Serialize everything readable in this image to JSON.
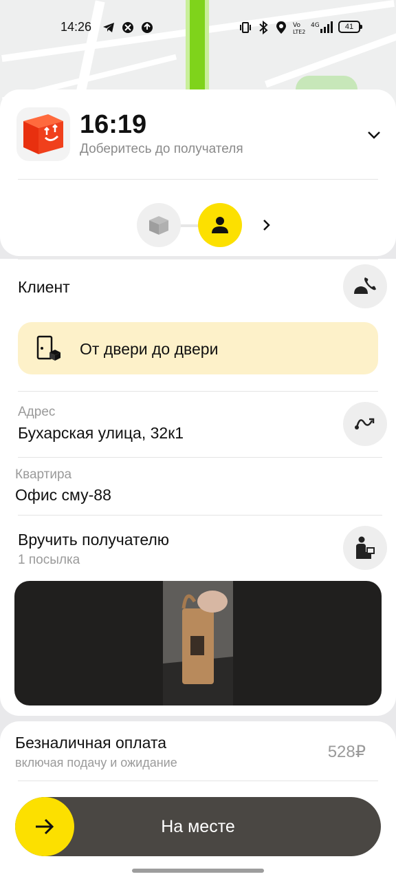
{
  "status_bar": {
    "time": "14:26",
    "battery": "41",
    "icons": [
      "telegram-icon",
      "vpn-icon",
      "upload-icon",
      "vibrate-icon",
      "bluetooth-icon",
      "location-icon",
      "volte-icon",
      "signal-4g-icon"
    ]
  },
  "order_header": {
    "eta": "16:19",
    "subtitle": "Доберитесь до получателя"
  },
  "client": {
    "label": "Клиент"
  },
  "door_to_door": {
    "label": "От двери до двери"
  },
  "address": {
    "caption": "Адрес",
    "value": "Бухарская улица, 32к1"
  },
  "apartment": {
    "caption": "Квартира",
    "value": "Офис сму-88"
  },
  "handover": {
    "title": "Вручить получателю",
    "subtitle": "1 посылка"
  },
  "payment": {
    "title": "Безналичная оплата",
    "subtitle": "включая подачу и ожидание",
    "amount": "528₽"
  },
  "action": {
    "label": "На месте"
  },
  "colors": {
    "accent": "#fce000",
    "action_bg": "#4a4743",
    "door_bg": "#fdf1c9",
    "route": "#7fd31b",
    "app_icon": "#f0401c"
  }
}
